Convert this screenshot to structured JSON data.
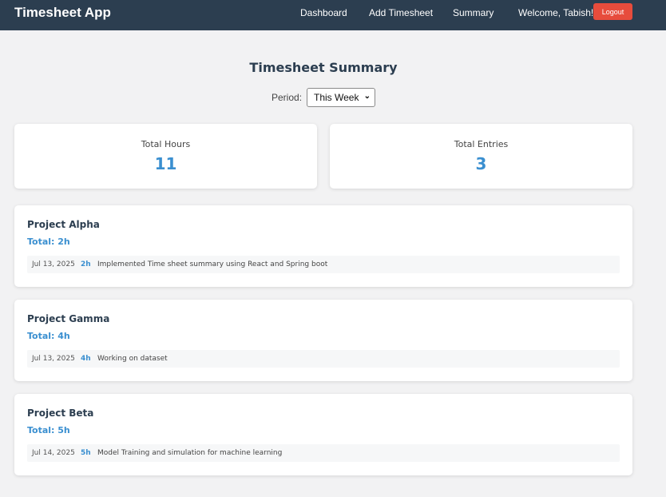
{
  "app": {
    "title": "Timesheet App"
  },
  "nav": {
    "links": [
      "Dashboard",
      "Add Timesheet",
      "Summary"
    ],
    "welcome": "Welcome, Tabish!",
    "logout_label": "Logout"
  },
  "page": {
    "title": "Timesheet Summary",
    "period_label": "Period:",
    "period_selected": "This Week"
  },
  "stats": {
    "total_hours_label": "Total Hours",
    "total_hours_value": "11",
    "total_entries_label": "Total Entries",
    "total_entries_value": "3"
  },
  "projects": [
    {
      "name": "Project Alpha",
      "total": "Total: 2h",
      "entries": [
        {
          "date": "Jul 13, 2025",
          "hours": "2h",
          "description": "Implemented Time sheet summary using React and Spring boot"
        }
      ]
    },
    {
      "name": "Project Gamma",
      "total": "Total: 4h",
      "entries": [
        {
          "date": "Jul 13, 2025",
          "hours": "4h",
          "description": "Working on dataset"
        }
      ]
    },
    {
      "name": "Project Beta",
      "total": "Total: 5h",
      "entries": [
        {
          "date": "Jul 14, 2025",
          "hours": "5h",
          "description": "Model Training and simulation for machine learning"
        }
      ]
    }
  ],
  "colors": {
    "navbar": "#2c3e50",
    "accent": "#3a8fd0",
    "logout": "#e74c3c",
    "background": "#f2f2f3"
  },
  "icons": {
    "select_chevron": "chevron-down-icon"
  }
}
